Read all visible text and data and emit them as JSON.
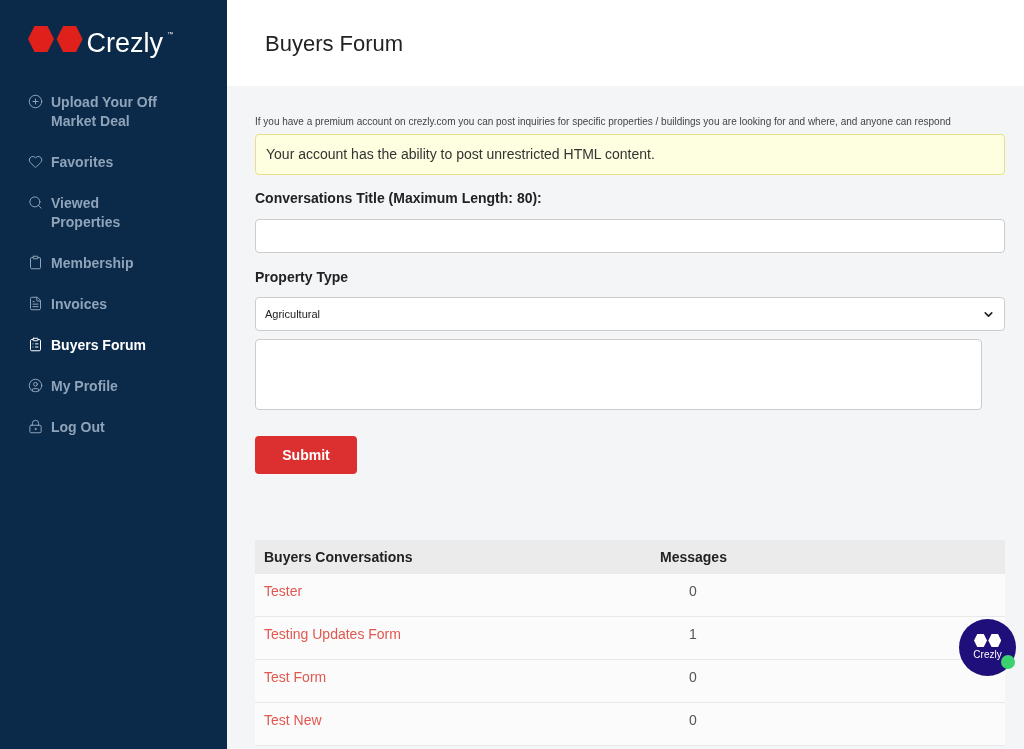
{
  "logo": {
    "text": "Crezly",
    "mark": "™"
  },
  "sidebar": {
    "items": [
      {
        "label": "Upload Your Off Market Deal",
        "selected": false
      },
      {
        "label": "Favorites",
        "selected": false
      },
      {
        "label": "Viewed Properties",
        "selected": false
      },
      {
        "label": "Membership",
        "selected": false
      },
      {
        "label": "Invoices",
        "selected": false
      },
      {
        "label": "Buyers Forum",
        "selected": true
      },
      {
        "label": "My Profile",
        "selected": false
      },
      {
        "label": "Log Out",
        "selected": false
      }
    ]
  },
  "page": {
    "title": "Buyers Forum"
  },
  "intro": "If you have a premium account on crezly.com you can post inquiries for specific properties / buildings you are looking for and where, and anyone can respond",
  "notice": "Your account has the ability to post unrestricted HTML content.",
  "form": {
    "title_label": "Conversations Title (Maximum Length: 80):",
    "type_label": "Property Type",
    "type_value": "Agricultural",
    "submit": "Submit"
  },
  "table": {
    "columns": [
      "Buyers Conversations",
      "Messages"
    ],
    "rows": [
      {
        "title": "Tester",
        "messages": "0"
      },
      {
        "title": "Testing Updates Form",
        "messages": "1"
      },
      {
        "title": "Test Form",
        "messages": "0"
      },
      {
        "title": "Test New",
        "messages": "0"
      }
    ]
  },
  "chat_badge": {
    "text": "Crezly",
    "online": true
  }
}
